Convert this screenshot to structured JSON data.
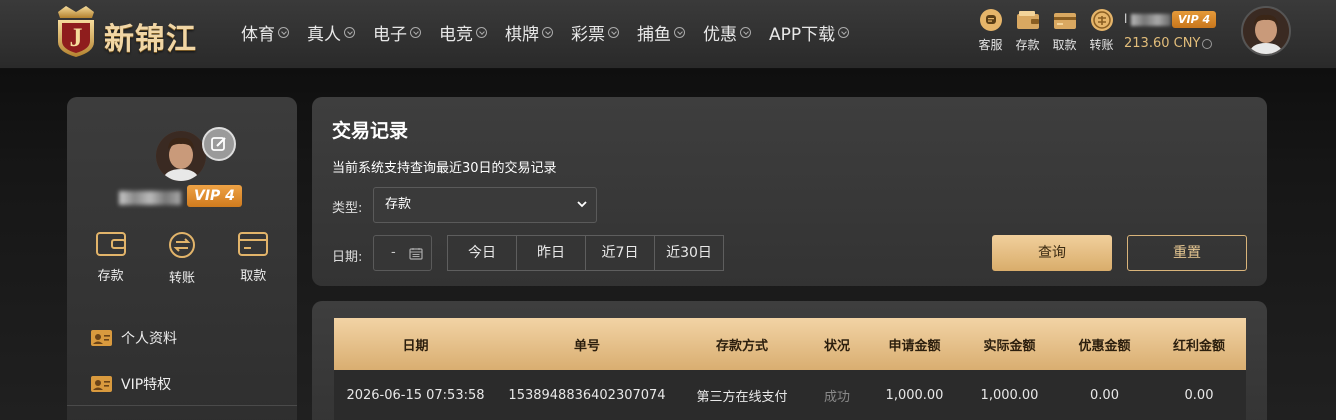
{
  "header": {
    "brand": "新锦江",
    "logo_letter": "J",
    "nav": [
      "体育",
      "真人",
      "电子",
      "电竞",
      "棋牌",
      "彩票",
      "捕鱼",
      "优惠",
      "APP下载"
    ],
    "quick_links": [
      {
        "label": "客服",
        "icon": "customer-service-icon"
      },
      {
        "label": "存款",
        "icon": "wallet-icon"
      },
      {
        "label": "取款",
        "icon": "withdraw-icon"
      },
      {
        "label": "转账",
        "icon": "transfer-icon"
      }
    ],
    "username_prefix": "l",
    "vip": "VIP 4",
    "balance": "213.60 CNY"
  },
  "sidebar": {
    "vip": "VIP 4",
    "actions": [
      {
        "label": "存款",
        "icon": "wallet-icon"
      },
      {
        "label": "转账",
        "icon": "transfer-icon"
      },
      {
        "label": "取款",
        "icon": "card-icon"
      }
    ],
    "menu": [
      {
        "label": "个人资料",
        "icon": "profile-card-icon"
      },
      {
        "label": "VIP特权",
        "icon": "vip-card-icon"
      }
    ]
  },
  "panel": {
    "title": "交易记录",
    "note": "当前系统支持查询最近30日的交易记录",
    "type_label": "类型:",
    "type_value": "存款",
    "date_label": "日期:",
    "date_value": "-",
    "quick_dates": [
      "今日",
      "昨日",
      "近7日",
      "近30日"
    ],
    "query": "查询",
    "reset": "重置"
  },
  "table": {
    "headers": [
      "日期",
      "单号",
      "存款方式",
      "状况",
      "申请金额",
      "实际金额",
      "优惠金额",
      "红利金额"
    ],
    "rows": [
      [
        "2026-06-15 07:53:58",
        "1538948836402307074",
        "第三方在线支付",
        "成功",
        "1,000.00",
        "1,000.00",
        "0.00",
        "0.00"
      ]
    ]
  },
  "colors": {
    "accent": "#d9ae71",
    "vip": "#e59a3a"
  }
}
